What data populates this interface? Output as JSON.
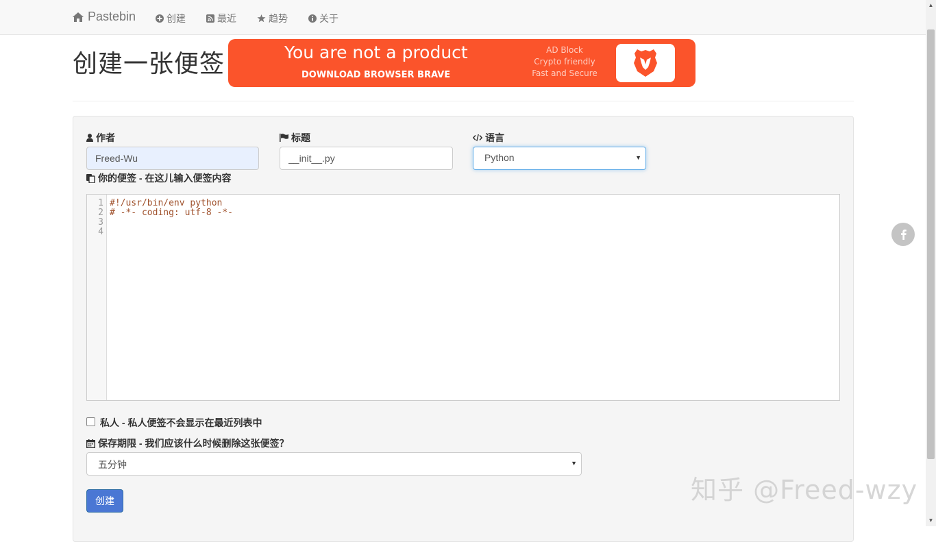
{
  "nav": {
    "brand": "Pastebin",
    "items": [
      {
        "label": "创建",
        "icon": "plus-circle-icon"
      },
      {
        "label": "最近",
        "icon": "rss-square-icon"
      },
      {
        "label": "趋势",
        "icon": "star-icon"
      },
      {
        "label": "关于",
        "icon": "info-circle-icon"
      }
    ]
  },
  "header": {
    "title": "创建一张便签",
    "ad": {
      "headline": "You are not a product",
      "subline": "DOWNLOAD BROWSER BRAVE",
      "features": [
        "AD Block",
        "Crypto friendly",
        "Fast and Secure"
      ],
      "logo_icon": "brave-lion-icon",
      "color": "#fb542b"
    }
  },
  "form": {
    "author": {
      "label": "作者",
      "icon": "user-icon",
      "value": "Freed-Wu"
    },
    "title": {
      "label": "标题",
      "icon": "flag-icon",
      "value": "__init__.py"
    },
    "language": {
      "label": "语言",
      "icon": "code-icon",
      "value": "Python"
    },
    "content": {
      "label": "你的便签 - 在这儿输入便签内容",
      "icon": "copy-icon",
      "lines": [
        {
          "num": "1",
          "text": "#!/usr/bin/env python"
        },
        {
          "num": "2",
          "text": "# -*- coding: utf-8 -*-"
        },
        {
          "num": "3",
          "text": ""
        },
        {
          "num": "4",
          "text": ""
        }
      ]
    },
    "private": {
      "label": "私人 - 私人便签不会显示在最近列表中",
      "checked": false
    },
    "expiry": {
      "label": "保存期限 - 我们应该什么时候删除这张便签？",
      "icon": "calendar-icon",
      "value": "五分钟"
    },
    "submit_label": "创建"
  },
  "watermark": "知乎 @Freed-wzy",
  "colors": {
    "primary": "#4a77d4",
    "brave": "#fb542b",
    "code": "#a0522d"
  }
}
